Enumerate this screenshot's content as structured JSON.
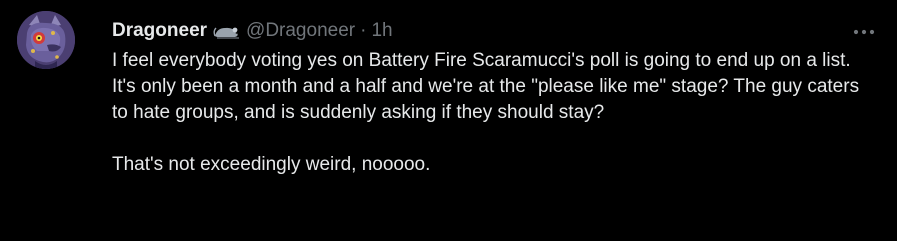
{
  "tweet": {
    "author": {
      "display_name": "Dragoneer",
      "handle": "@Dragoneer",
      "badge_icon": "rat-emoji-icon",
      "avatar_icon": "purple-dragon-avatar"
    },
    "separator": "·",
    "timestamp": "1h",
    "more_icon": "more-horizontal-icon",
    "paragraphs": [
      "I feel everybody voting yes on Battery Fire Scaramucci's poll is going to end up on a list. It's only been a month and a half and we're at the \"please like me\" stage? The guy caters to hate groups, and is suddenly asking if they should stay?",
      "That's not exceedingly weird, nooooo."
    ]
  },
  "colors": {
    "background": "#000000",
    "primary_text": "#e7e9ea",
    "secondary_text": "#71767b"
  }
}
